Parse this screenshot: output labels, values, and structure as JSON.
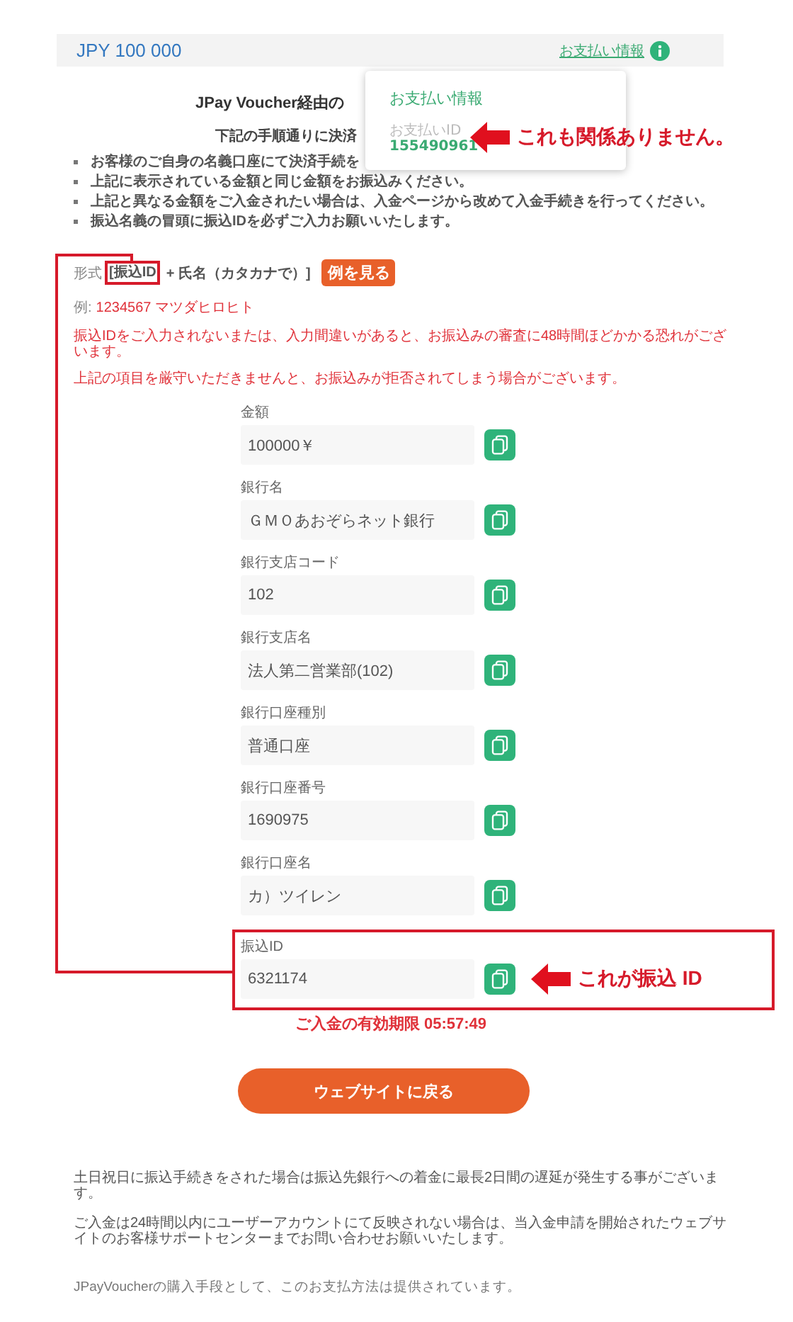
{
  "header": {
    "amount": "JPY 100 000",
    "info_link": "お支払い情報"
  },
  "popover": {
    "title": "お支払い情報",
    "id_label": "お支払いID",
    "id_value": "155490961"
  },
  "title": "JPay Voucher経由の",
  "subtitle": "下記の手順通りに決済",
  "bullets": [
    "お客様のご自身の名義口座にて決済手続を",
    "上記に表示されている金額と同じ金額をお振込みください。",
    "上記と異なる金額をご入金されたい場合は、入金ページから改めて入金手続きを行ってください。",
    "振込名義の冒頭に振込IDを必ずご入力お願いいたします。"
  ],
  "format": {
    "label": "形式",
    "id_part": "[振込ID",
    "rest": "+ 氏名（カタカナで）]",
    "example_button": "例を見る"
  },
  "example": {
    "label": "例:",
    "value": "1234567 マツダヒロヒト"
  },
  "warnings": [
    "振込IDをご入力されないまたは、入力間違いがあると、お振込みの審査に48時間ほどかかる恐れがございます。",
    "上記の項目を厳守いただきませんと、お振込みが拒否されてしまう場合がございます。"
  ],
  "fields": [
    {
      "label": "金額",
      "value": "100000￥"
    },
    {
      "label": "銀行名",
      "value": "ＧＭＯあおぞらネット銀行"
    },
    {
      "label": "銀行支店コード",
      "value": "102"
    },
    {
      "label": "銀行支店名",
      "value": "法人第二営業部(102)"
    },
    {
      "label": "銀行口座種別",
      "value": "普通口座"
    },
    {
      "label": "銀行口座番号",
      "value": "1690975"
    },
    {
      "label": "銀行口座名",
      "value": "カ）ツイレン"
    },
    {
      "label": "振込ID",
      "value": "6321174"
    }
  ],
  "expiry": "ご入金の有効期限 05:57:49",
  "back_button": "ウェブサイトに戻る",
  "notes": [
    "土日祝日に振込手続きをされた場合は振込先銀行への着金に最長2日間の遅延が発生する事がございます。",
    "ご入金は24時間以内にユーザーアカウントにて反映されない場合は、当入金申請を開始されたウェブサイトのお客様サポートセンターまでお問い合わせお願いいたします。"
  ],
  "footer": "JPayVoucherの購入手段として、このお支払方法は提供されています。",
  "annotations": [
    {
      "kind": "popover",
      "text": "これも関係ありません。"
    },
    {
      "kind": "field",
      "text": "これが振込 ID"
    }
  ]
}
